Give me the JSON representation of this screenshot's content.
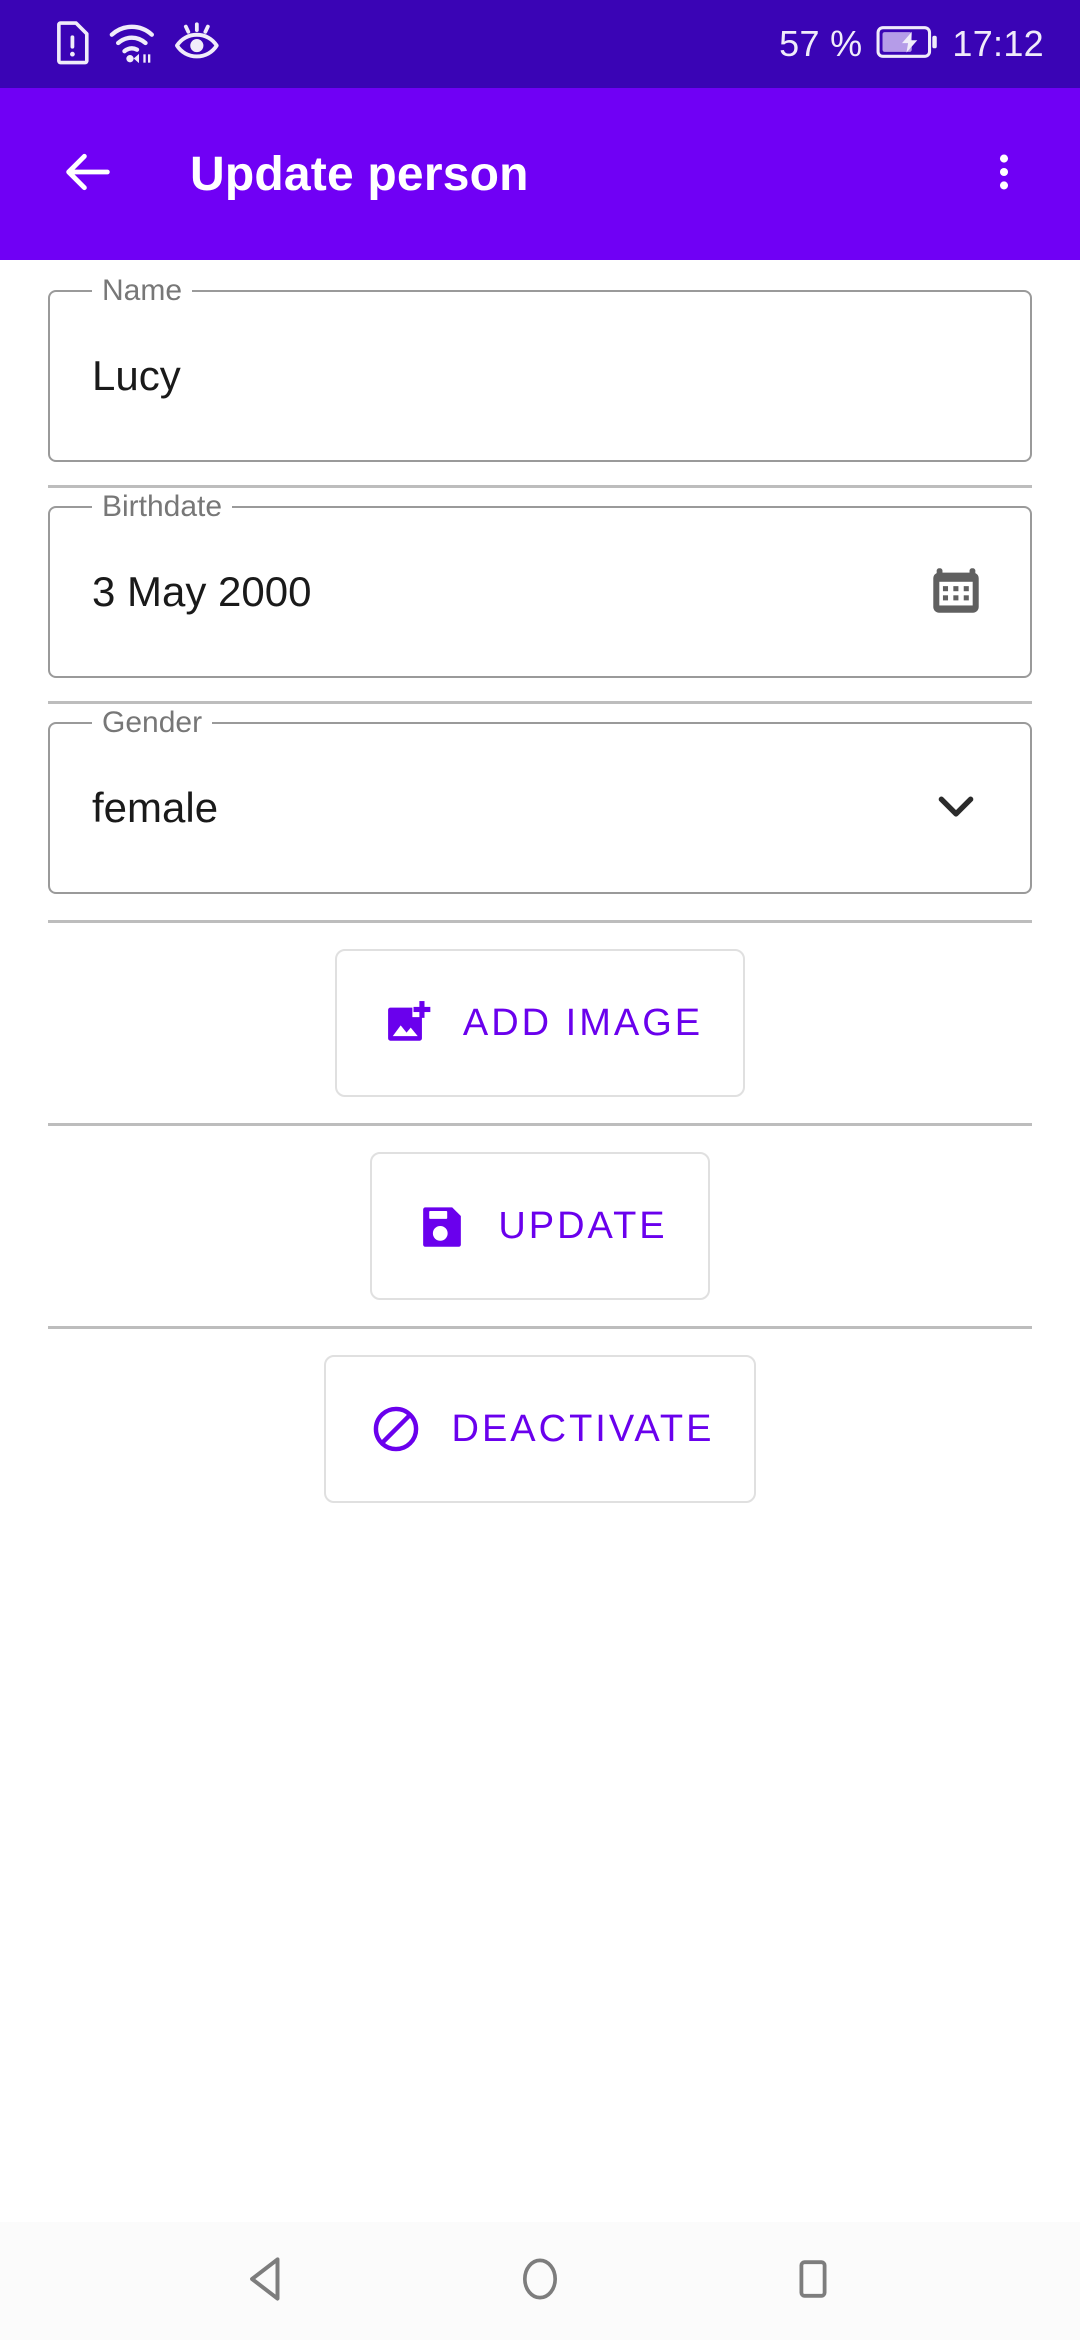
{
  "theme": {
    "status_bar_bg": "#3a04b5",
    "app_bar_bg": "#7000f5",
    "accent": "#6a00ed",
    "page_bg": "#ffffff",
    "nav_bar_bg": "#fbfbfb",
    "divider": "#bdbdbd",
    "field_border": "#9a9a9a",
    "label_text": "#777777",
    "value_text": "#1a1a1a"
  },
  "status_bar": {
    "left_icons": [
      {
        "name": "sim-card-alert-icon"
      },
      {
        "name": "wifi-icon"
      },
      {
        "name": "eye-comfort-icon"
      }
    ],
    "battery_percent": "57 %",
    "battery_icon": "battery-charging-icon",
    "time": "17:12"
  },
  "app_bar": {
    "back_icon": "arrow-left-icon",
    "title": "Update person",
    "overflow_icon": "more-vert-icon"
  },
  "form": {
    "fields": [
      {
        "key": "name",
        "label": "Name",
        "value": "Lucy",
        "placeholder": "Name",
        "trailing_icon": null
      },
      {
        "key": "birthdate",
        "label": "Birthdate",
        "value": "3 May 2000",
        "placeholder": "Birthdate",
        "trailing_icon": "calendar-icon"
      },
      {
        "key": "gender",
        "label": "Gender",
        "value": "female",
        "placeholder": "Gender",
        "trailing_icon": "chevron-down-icon"
      }
    ]
  },
  "actions": [
    {
      "key": "add-image",
      "label": "ADD IMAGE",
      "icon": "add-photo-icon"
    },
    {
      "key": "update",
      "label": "UPDATE",
      "icon": "save-icon"
    },
    {
      "key": "deactivate",
      "label": "DEACTIVATE",
      "icon": "block-icon"
    }
  ],
  "nav_bar": {
    "back_label": "back-triangle-icon",
    "home_label": "home-circle-icon",
    "recents_label": "recents-square-icon"
  }
}
